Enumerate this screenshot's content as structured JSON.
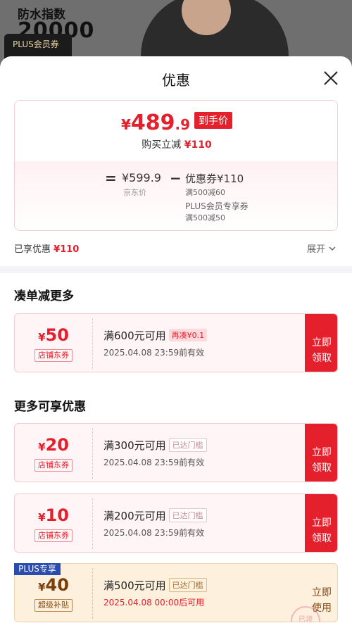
{
  "background": {
    "spec_label": "防水指数",
    "spec_value": "20000",
    "plus_label": "PLUS会员券"
  },
  "sheet": {
    "title": "优惠",
    "close_icon": "close-icon"
  },
  "summary": {
    "price_symbol": "¥",
    "price_int": "489",
    "price_dec": ".9",
    "price_tag": "到手价",
    "save_text": "购买立减",
    "save_amount": "¥110",
    "equals": "=",
    "original_price": "¥599.9",
    "original_label": "京东价",
    "minus": "−",
    "coupon_total": "优惠券¥110",
    "coupon_detail_1": "满500减60",
    "coupon_detail_2": "PLUS会员专享券",
    "coupon_detail_3": "满500减50"
  },
  "enjoyed": {
    "text": "已享优惠",
    "amount": "¥110",
    "expand": "展开"
  },
  "sections": {
    "stack_title": "凑单减更多",
    "more_title": "更多可享优惠"
  },
  "coupons": [
    {
      "symbol": "¥",
      "amount": "50",
      "type": "店铺东券",
      "condition": "满600元可用",
      "badge": "再凑¥0.1",
      "valid": "2025.04.08 23:59前有效",
      "button": "立即领取"
    },
    {
      "symbol": "¥",
      "amount": "20",
      "type": "店铺东券",
      "condition": "满300元可用",
      "badge": "已达门槛",
      "valid": "2025.04.08 23:59前有效",
      "button": "立即领取"
    },
    {
      "symbol": "¥",
      "amount": "10",
      "type": "店铺东券",
      "condition": "满200元可用",
      "badge": "已达门槛",
      "valid": "2025.04.08 23:59前有效",
      "button": "立即领取"
    },
    {
      "plus_tag": "PLUS专享",
      "symbol": "¥",
      "amount": "40",
      "type": "超级补贴",
      "condition": "满500元可用",
      "badge": "已达门槛",
      "valid": "2025.04.08 00:00后可用",
      "button": "立即使用",
      "stamp": "已领"
    }
  ],
  "colors": {
    "accent_red": "#e4202d",
    "plus_blue": "#2a4cad",
    "plus_gold": "#8a4a14"
  }
}
